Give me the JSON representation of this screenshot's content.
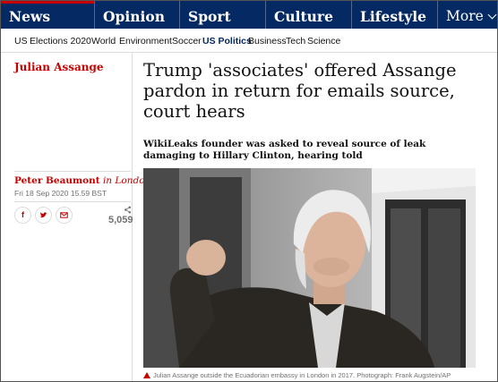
{
  "pillars": [
    {
      "label": "News",
      "active": true
    },
    {
      "label": "Opinion",
      "active": false
    },
    {
      "label": "Sport",
      "active": false
    },
    {
      "label": "Culture",
      "active": false
    },
    {
      "label": "Lifestyle",
      "active": false
    }
  ],
  "more_label": "More",
  "subnav": [
    {
      "label": "US",
      "current": false
    },
    {
      "label": "Elections 2020",
      "current": false
    },
    {
      "label": "World",
      "current": false
    },
    {
      "label": "Environment",
      "current": false
    },
    {
      "label": "Soccer",
      "current": false
    },
    {
      "label": "US Politics",
      "current": true
    },
    {
      "label": "Business",
      "current": false
    },
    {
      "label": "Tech",
      "current": false
    },
    {
      "label": "Science",
      "current": false
    }
  ],
  "article": {
    "section": "Julian Assange",
    "headline": "Trump 'associates' offered Assange pardon in return for emails source, court hears",
    "standfirst": "WikiLeaks founder was asked to reveal source of leak damaging to Hillary Clinton, hearing told",
    "author": "Peter Beaumont",
    "location": "in London",
    "date": "Fri 18 Sep 2020 15.59 BST",
    "share_count": "5,059",
    "share_icons": [
      "facebook-icon",
      "twitter-icon",
      "email-icon"
    ],
    "caption": "Julian Assange outside the Ecuadorian embassy in London in 2017. Photograph: Frank Augstein/AP"
  },
  "colors": {
    "brand": "#052962",
    "news_red": "#c70000",
    "rule": "#dcdcdc"
  }
}
